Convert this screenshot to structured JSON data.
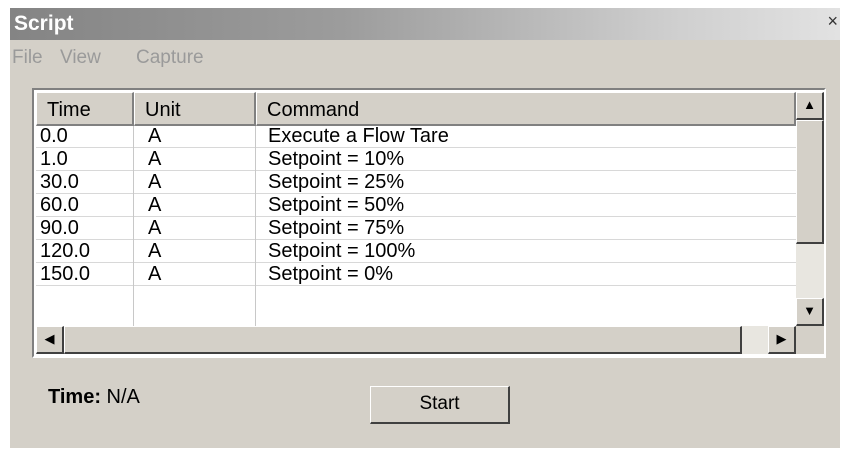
{
  "window": {
    "title": "Script",
    "close_glyph": "×"
  },
  "menu": {
    "items": [
      "File",
      "View",
      "Capture"
    ]
  },
  "table": {
    "columns": [
      "Time",
      "Unit",
      "Command"
    ],
    "rows": [
      {
        "time": "0.0",
        "unit": "A",
        "command": "Execute a Flow Tare"
      },
      {
        "time": "1.0",
        "unit": "A",
        "command": "Setpoint = 10%"
      },
      {
        "time": "30.0",
        "unit": "A",
        "command": "Setpoint = 25%"
      },
      {
        "time": "60.0",
        "unit": "A",
        "command": "Setpoint = 50%"
      },
      {
        "time": "90.0",
        "unit": "A",
        "command": "Setpoint = 75%"
      },
      {
        "time": "120.0",
        "unit": "A",
        "command": "Setpoint = 100%"
      },
      {
        "time": "150.0",
        "unit": "A",
        "command": "Setpoint = 0%"
      }
    ]
  },
  "scroll": {
    "up": "▲",
    "down": "▼",
    "left": "◀",
    "right": "▶"
  },
  "status": {
    "label": "Time:",
    "value": "N/A"
  },
  "buttons": {
    "start": "Start"
  }
}
